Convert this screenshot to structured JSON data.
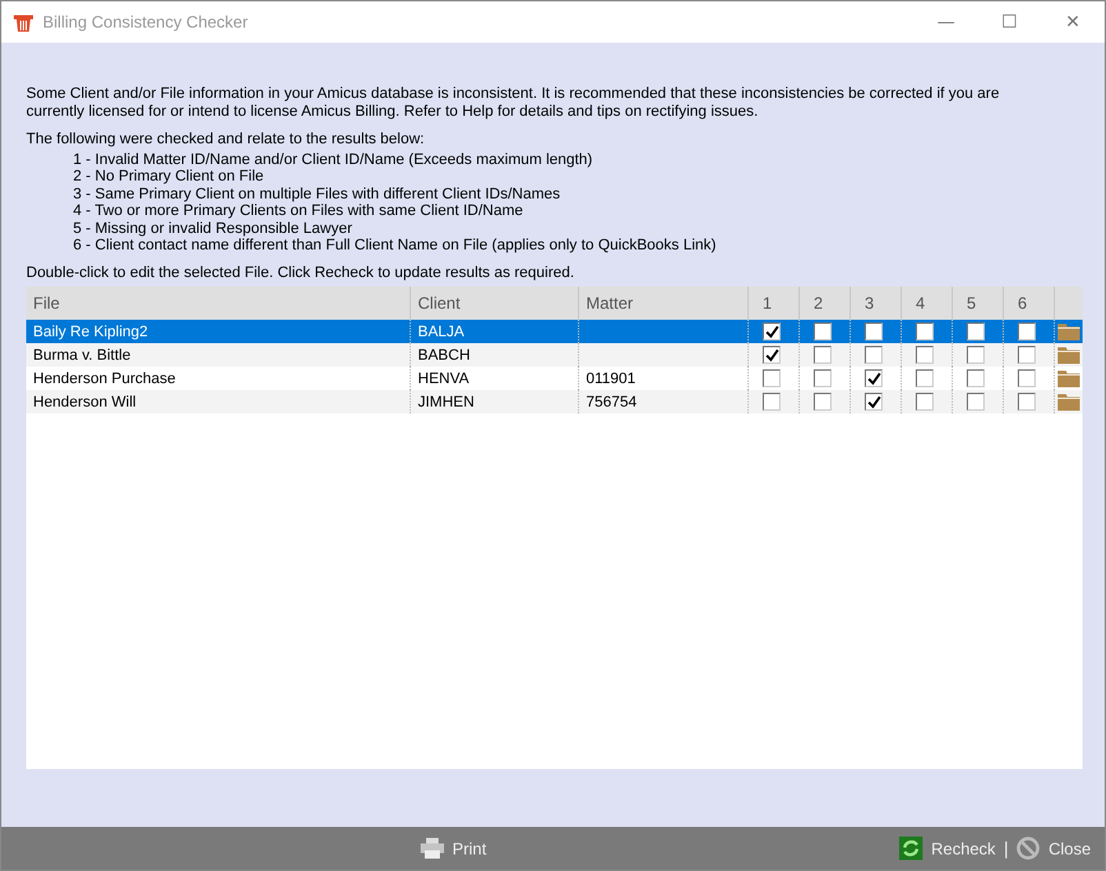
{
  "window": {
    "title": "Billing Consistency Checker",
    "controls": [
      "—",
      "☐",
      "✕"
    ]
  },
  "intro": "Some Client and/or File information in your Amicus database is inconsistent. It is recommended that these inconsistencies be corrected if you are currently licensed for or intend to license Amicus Billing. Refer to Help for details and tips on rectifying issues.",
  "checks_heading": "The following were checked and relate to the results below:",
  "checks": [
    "1 - Invalid Matter ID/Name and/or Client ID/Name (Exceeds maximum length)",
    "2 - No Primary Client on File",
    "3 - Same Primary Client on multiple Files with different Client IDs/Names",
    "4 - Two or more Primary Clients on Files with same Client ID/Name",
    "5 - Missing or invalid Responsible Lawyer",
    "6 - Client contact name different than Full Client Name on File (applies only to QuickBooks Link)"
  ],
  "hint": "Double-click to edit the selected File. Click Recheck to update results as required.",
  "table": {
    "columns": [
      "File",
      "Client",
      "Matter",
      "1",
      "2",
      "3",
      "4",
      "5",
      "6"
    ],
    "rows": [
      {
        "file": "Baily Re Kipling2",
        "client": "BALJA",
        "matter": "",
        "selected": true,
        "checks": [
          true,
          false,
          false,
          false,
          false,
          false
        ]
      },
      {
        "file": "Burma v. Bittle",
        "client": "BABCH",
        "matter": "",
        "selected": false,
        "checks": [
          true,
          false,
          false,
          false,
          false,
          false
        ]
      },
      {
        "file": "Henderson Purchase",
        "client": "HENVA",
        "matter": "011901",
        "selected": false,
        "checks": [
          false,
          false,
          true,
          false,
          false,
          false
        ]
      },
      {
        "file": "Henderson Will",
        "client": "JIMHEN",
        "matter": "756754",
        "selected": false,
        "checks": [
          false,
          false,
          true,
          false,
          false,
          false
        ]
      }
    ]
  },
  "footer": {
    "print": "Print",
    "recheck": "Recheck",
    "separator": "|",
    "close": "Close"
  }
}
